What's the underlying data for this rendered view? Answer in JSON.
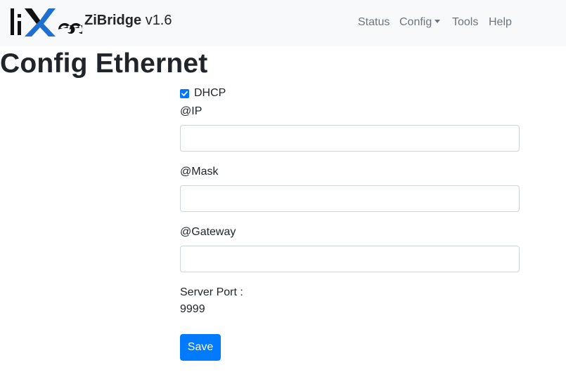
{
  "navbar": {
    "logo_text": "lixee",
    "brand_name": "ZiBridge",
    "brand_version": "v1.6",
    "links": [
      {
        "label": "Status"
      },
      {
        "label": "Config",
        "dropdown": true
      },
      {
        "label": "Tools"
      },
      {
        "label": "Help"
      }
    ]
  },
  "page": {
    "title": "Config Ethernet"
  },
  "form": {
    "dhcp_label": "DHCP",
    "dhcp_checked": true,
    "ip_label": "@IP",
    "ip_value": "",
    "mask_label": "@Mask",
    "mask_value": "",
    "gateway_label": "@Gateway",
    "gateway_value": "",
    "server_port_label": "Server Port :",
    "server_port_value": "9999",
    "save_label": "Save"
  },
  "colors": {
    "navbar_bg": "#f8f9fa",
    "logo_dark": "#111111",
    "logo_accent": "#1f6fd1",
    "primary": "#007bff",
    "nav_text": "#6c757d"
  },
  "icons": {
    "logo": "lixee-logo",
    "checkbox": "checkmark-icon",
    "dropdown": "caret-down-icon"
  }
}
